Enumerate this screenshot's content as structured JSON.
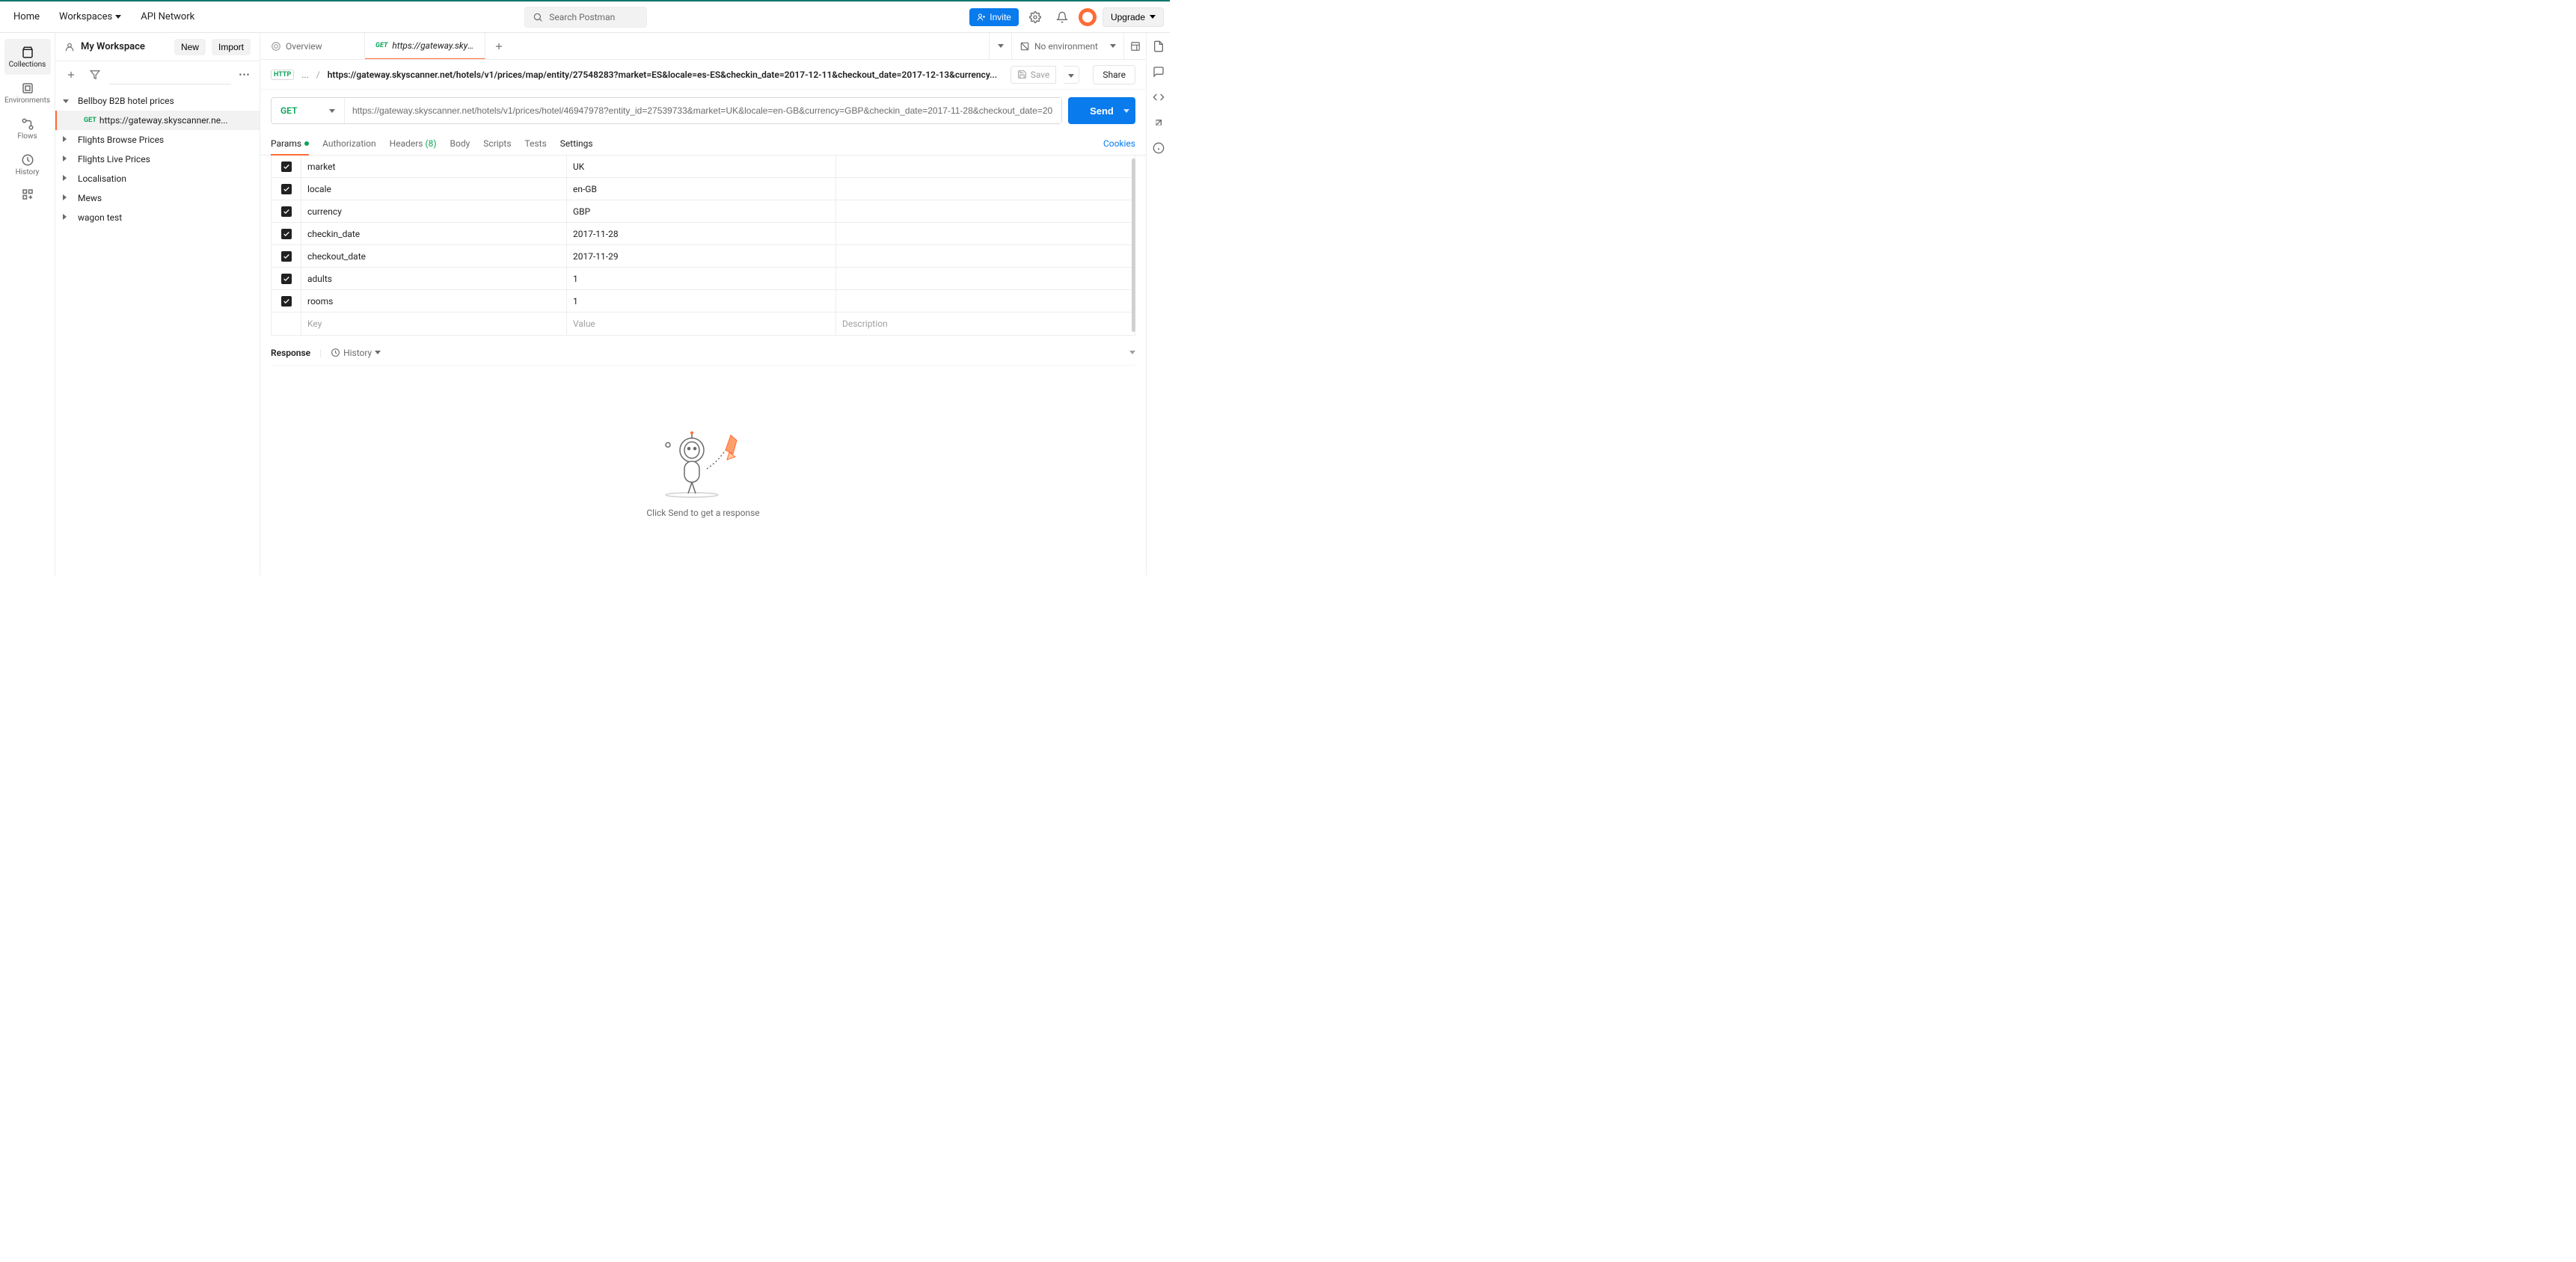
{
  "header": {
    "nav": {
      "home": "Home",
      "workspaces": "Workspaces",
      "api_network": "API Network"
    },
    "search_placeholder": "Search Postman",
    "invite": "Invite",
    "upgrade": "Upgrade"
  },
  "left_rail": {
    "collections": "Collections",
    "environments": "Environments",
    "flows": "Flows",
    "history": "History"
  },
  "sidebar": {
    "workspace_title": "My Workspace",
    "new_btn": "New",
    "import_btn": "Import",
    "collections": [
      {
        "name": "Bellboy B2B hotel prices",
        "expanded": true,
        "children": [
          {
            "method": "GET",
            "name": "https://gateway.skyscanner.ne...",
            "selected": true
          }
        ]
      },
      {
        "name": "Flights Browse Prices",
        "expanded": false
      },
      {
        "name": "Flights Live Prices",
        "expanded": false
      },
      {
        "name": "Localisation",
        "expanded": false
      },
      {
        "name": "Mews",
        "expanded": false
      },
      {
        "name": "wagon test",
        "expanded": false
      }
    ]
  },
  "tabs": {
    "overview": "Overview",
    "active": {
      "method": "GET",
      "label": "https://gateway.skyscan"
    },
    "env_label": "No environment"
  },
  "request": {
    "breadcrumb_prefix": "...",
    "breadcrumb": "https://gateway.skyscanner.net/hotels/v1/prices/map/entity/27548283?market=ES&locale=es-ES&checkin_date=2017-12-11&checkout_date=2017-12-13&currency...",
    "save": "Save",
    "share": "Share",
    "method": "GET",
    "url": "https://gateway.skyscanner.net/hotels/v1/prices/hotel/46947978?entity_id=27539733&market=UK&locale=en-GB&currency=GBP&checkin_date=2017-11-28&checkout_date=20",
    "send": "Send",
    "tabs": {
      "params": "Params",
      "authorization": "Authorization",
      "headers": "Headers",
      "headers_count": "(8)",
      "body": "Body",
      "scripts": "Scripts",
      "tests": "Tests",
      "settings": "Settings",
      "cookies": "Cookies"
    },
    "params": [
      {
        "key": "market",
        "value": "UK"
      },
      {
        "key": "locale",
        "value": "en-GB"
      },
      {
        "key": "currency",
        "value": "GBP"
      },
      {
        "key": "checkin_date",
        "value": "2017-11-28"
      },
      {
        "key": "checkout_date",
        "value": "2017-11-29"
      },
      {
        "key": "adults",
        "value": "1"
      },
      {
        "key": "rooms",
        "value": "1"
      }
    ],
    "param_placeholders": {
      "key": "Key",
      "value": "Value",
      "description": "Description"
    }
  },
  "response": {
    "title": "Response",
    "history": "History",
    "empty_text": "Click Send to get a response"
  }
}
